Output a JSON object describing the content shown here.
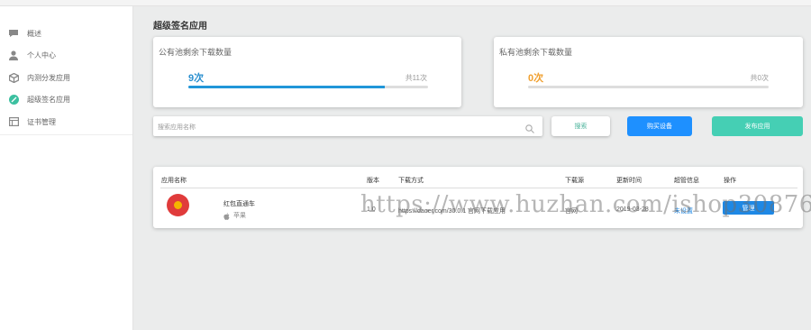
{
  "sidebar": {
    "items": [
      {
        "label": "概述",
        "icon": "chat-icon"
      },
      {
        "label": "个人中心",
        "icon": "user-icon"
      },
      {
        "label": "内测分发应用",
        "icon": "box-icon"
      },
      {
        "label": "超级签名应用",
        "icon": "leaf-icon"
      },
      {
        "label": "证书管理",
        "icon": "certificate-icon"
      }
    ]
  },
  "page": {
    "title": "超级签名应用"
  },
  "public_card": {
    "title": "公有池剩余下载数量",
    "count": "9次",
    "total": "共11次",
    "progress": 0.82,
    "count_color": "#2a8fcf"
  },
  "private_card": {
    "title": "私有池剩余下载数量",
    "count": "0次",
    "total": "共0次",
    "progress": 0,
    "count_color": "#f0a030"
  },
  "search": {
    "placeholder": "搜索应用名称",
    "button": "搜索"
  },
  "actions": {
    "buy": "购买设备",
    "publish": "发布应用"
  },
  "table": {
    "headers": [
      "应用名称",
      "版本",
      "下载方式",
      "下载源",
      "更新时间",
      "超管信息",
      "操作"
    ],
    "rows": [
      {
        "name": "红包直通车",
        "platform": "苹果",
        "version": "1.0",
        "download": "https://daoer.com/30.0.1 官网下载应用",
        "source": "官网",
        "updated": "2019-03-28",
        "admin": "未设置",
        "op": "管理"
      }
    ]
  },
  "watermark": "https://www.huzhan.com/ishop30876"
}
